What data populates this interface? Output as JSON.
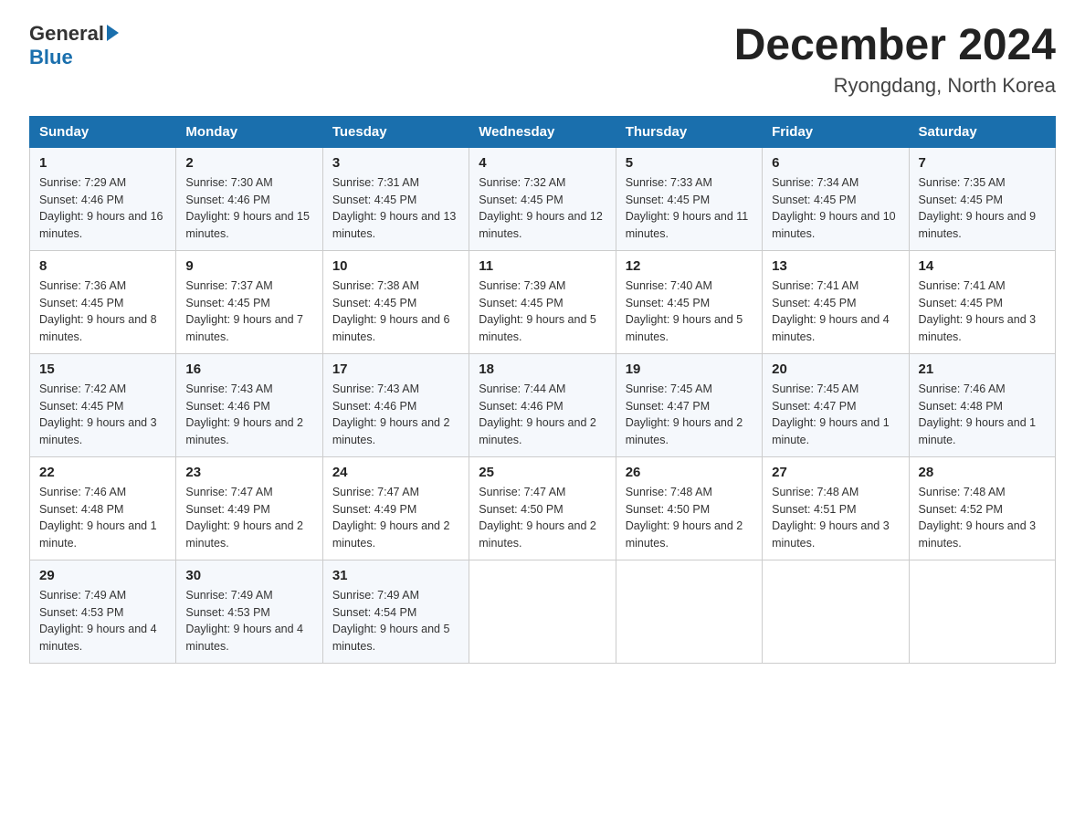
{
  "logo": {
    "text_general": "General",
    "text_blue": "Blue"
  },
  "header": {
    "month_title": "December 2024",
    "location": "Ryongdang, North Korea"
  },
  "days_of_week": [
    "Sunday",
    "Monday",
    "Tuesday",
    "Wednesday",
    "Thursday",
    "Friday",
    "Saturday"
  ],
  "weeks": [
    [
      {
        "day": "1",
        "sunrise": "7:29 AM",
        "sunset": "4:46 PM",
        "daylight": "9 hours and 16 minutes."
      },
      {
        "day": "2",
        "sunrise": "7:30 AM",
        "sunset": "4:46 PM",
        "daylight": "9 hours and 15 minutes."
      },
      {
        "day": "3",
        "sunrise": "7:31 AM",
        "sunset": "4:45 PM",
        "daylight": "9 hours and 13 minutes."
      },
      {
        "day": "4",
        "sunrise": "7:32 AM",
        "sunset": "4:45 PM",
        "daylight": "9 hours and 12 minutes."
      },
      {
        "day": "5",
        "sunrise": "7:33 AM",
        "sunset": "4:45 PM",
        "daylight": "9 hours and 11 minutes."
      },
      {
        "day": "6",
        "sunrise": "7:34 AM",
        "sunset": "4:45 PM",
        "daylight": "9 hours and 10 minutes."
      },
      {
        "day": "7",
        "sunrise": "7:35 AM",
        "sunset": "4:45 PM",
        "daylight": "9 hours and 9 minutes."
      }
    ],
    [
      {
        "day": "8",
        "sunrise": "7:36 AM",
        "sunset": "4:45 PM",
        "daylight": "9 hours and 8 minutes."
      },
      {
        "day": "9",
        "sunrise": "7:37 AM",
        "sunset": "4:45 PM",
        "daylight": "9 hours and 7 minutes."
      },
      {
        "day": "10",
        "sunrise": "7:38 AM",
        "sunset": "4:45 PM",
        "daylight": "9 hours and 6 minutes."
      },
      {
        "day": "11",
        "sunrise": "7:39 AM",
        "sunset": "4:45 PM",
        "daylight": "9 hours and 5 minutes."
      },
      {
        "day": "12",
        "sunrise": "7:40 AM",
        "sunset": "4:45 PM",
        "daylight": "9 hours and 5 minutes."
      },
      {
        "day": "13",
        "sunrise": "7:41 AM",
        "sunset": "4:45 PM",
        "daylight": "9 hours and 4 minutes."
      },
      {
        "day": "14",
        "sunrise": "7:41 AM",
        "sunset": "4:45 PM",
        "daylight": "9 hours and 3 minutes."
      }
    ],
    [
      {
        "day": "15",
        "sunrise": "7:42 AM",
        "sunset": "4:45 PM",
        "daylight": "9 hours and 3 minutes."
      },
      {
        "day": "16",
        "sunrise": "7:43 AM",
        "sunset": "4:46 PM",
        "daylight": "9 hours and 2 minutes."
      },
      {
        "day": "17",
        "sunrise": "7:43 AM",
        "sunset": "4:46 PM",
        "daylight": "9 hours and 2 minutes."
      },
      {
        "day": "18",
        "sunrise": "7:44 AM",
        "sunset": "4:46 PM",
        "daylight": "9 hours and 2 minutes."
      },
      {
        "day": "19",
        "sunrise": "7:45 AM",
        "sunset": "4:47 PM",
        "daylight": "9 hours and 2 minutes."
      },
      {
        "day": "20",
        "sunrise": "7:45 AM",
        "sunset": "4:47 PM",
        "daylight": "9 hours and 1 minute."
      },
      {
        "day": "21",
        "sunrise": "7:46 AM",
        "sunset": "4:48 PM",
        "daylight": "9 hours and 1 minute."
      }
    ],
    [
      {
        "day": "22",
        "sunrise": "7:46 AM",
        "sunset": "4:48 PM",
        "daylight": "9 hours and 1 minute."
      },
      {
        "day": "23",
        "sunrise": "7:47 AM",
        "sunset": "4:49 PM",
        "daylight": "9 hours and 2 minutes."
      },
      {
        "day": "24",
        "sunrise": "7:47 AM",
        "sunset": "4:49 PM",
        "daylight": "9 hours and 2 minutes."
      },
      {
        "day": "25",
        "sunrise": "7:47 AM",
        "sunset": "4:50 PM",
        "daylight": "9 hours and 2 minutes."
      },
      {
        "day": "26",
        "sunrise": "7:48 AM",
        "sunset": "4:50 PM",
        "daylight": "9 hours and 2 minutes."
      },
      {
        "day": "27",
        "sunrise": "7:48 AM",
        "sunset": "4:51 PM",
        "daylight": "9 hours and 3 minutes."
      },
      {
        "day": "28",
        "sunrise": "7:48 AM",
        "sunset": "4:52 PM",
        "daylight": "9 hours and 3 minutes."
      }
    ],
    [
      {
        "day": "29",
        "sunrise": "7:49 AM",
        "sunset": "4:53 PM",
        "daylight": "9 hours and 4 minutes."
      },
      {
        "day": "30",
        "sunrise": "7:49 AM",
        "sunset": "4:53 PM",
        "daylight": "9 hours and 4 minutes."
      },
      {
        "day": "31",
        "sunrise": "7:49 AM",
        "sunset": "4:54 PM",
        "daylight": "9 hours and 5 minutes."
      },
      null,
      null,
      null,
      null
    ]
  ],
  "labels": {
    "sunrise": "Sunrise:",
    "sunset": "Sunset:",
    "daylight": "Daylight:"
  }
}
